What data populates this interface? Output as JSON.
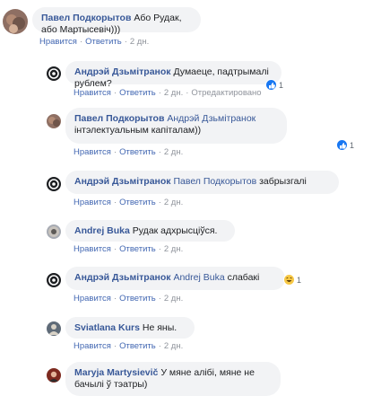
{
  "comments": [
    {
      "author": "Павел Подкорытов",
      "text": "Або Рудак, або Мартысевіч)))",
      "actions": {
        "like": "Нравится",
        "reply": "Ответить",
        "time": "2 дн."
      }
    },
    {
      "author": "Андрэй Дзьмітранок",
      "text": "Думаеце, падтрымалі рублем?",
      "actions": {
        "like": "Нравится",
        "reply": "Ответить",
        "time": "2 дн.",
        "edited": "Отредактировано"
      },
      "reaction": {
        "icon": "like-icon",
        "count": "1"
      }
    },
    {
      "author": "Павел Подкорытов",
      "mention": "Андрэй Дзьмітранок",
      "text": "інтэлектуальным капіталам))",
      "actions": {
        "like": "Нравится",
        "reply": "Ответить",
        "time": "2 дн."
      },
      "reaction": {
        "icon": "like-icon",
        "count": "1"
      }
    },
    {
      "author": "Андрэй Дзьмітранок",
      "mention": "Павел Подкорытов",
      "text": "забрызгалі",
      "actions": {
        "like": "Нравится",
        "reply": "Ответить",
        "time": "2 дн."
      }
    },
    {
      "author": "Andrej Buka",
      "text": "Рудак адхрысціўся.",
      "actions": {
        "like": "Нравится",
        "reply": "Ответить",
        "time": "2 дн."
      }
    },
    {
      "author": "Андрэй Дзьмітранок",
      "mention": "Andrej Buka",
      "text": "слабакі",
      "actions": {
        "like": "Нравится",
        "reply": "Ответить",
        "time": "2 дн."
      },
      "reaction": {
        "icon": "haha-icon",
        "count": "1"
      }
    },
    {
      "author": "Sviatlana Kurs",
      "text": "Не яны.",
      "actions": {
        "like": "Нравится",
        "reply": "Ответить",
        "time": "2 дн."
      }
    },
    {
      "author": "Maryja Martysievič",
      "text": "У мяне алібі, мяне не бачылі ў тэатры)",
      "actions": {}
    }
  ],
  "colors": {
    "link": "#385898",
    "bubble": "#f2f3f5",
    "like_blue": "#1877f2",
    "meta": "#90949c"
  }
}
